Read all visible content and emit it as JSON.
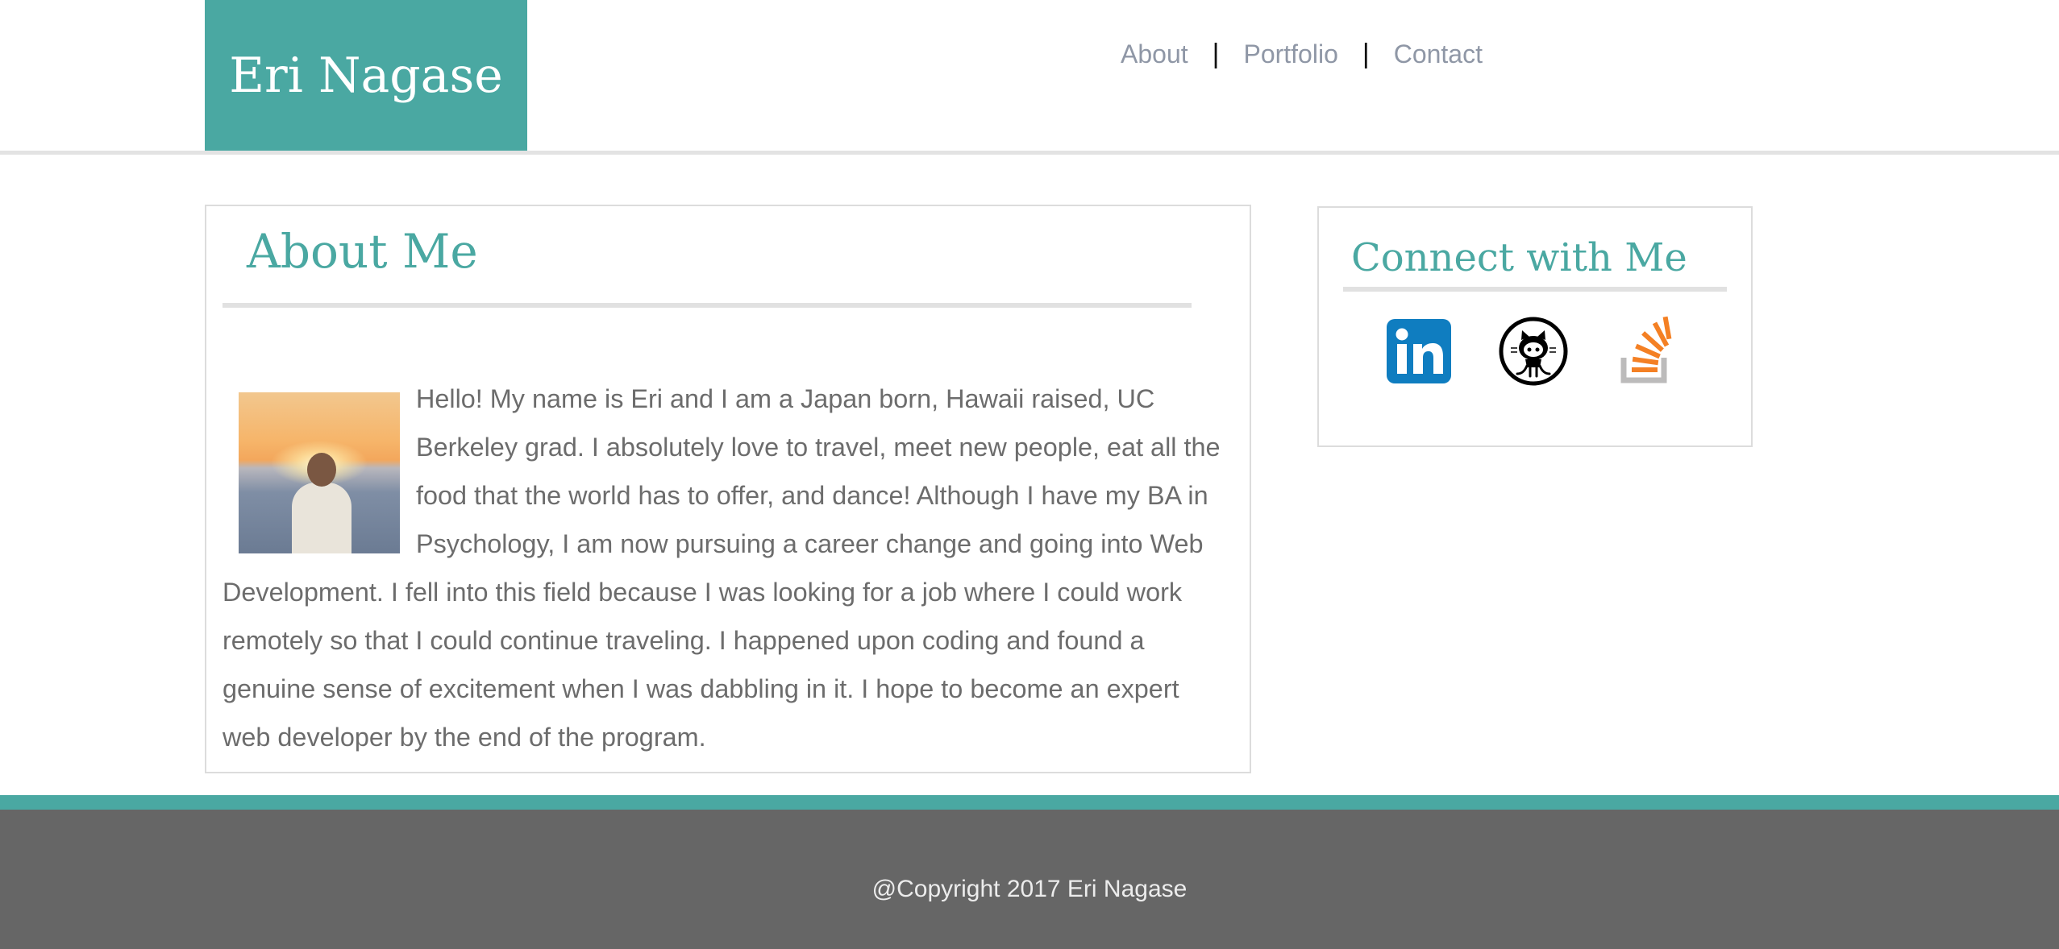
{
  "header": {
    "brand": "Eri Nagase",
    "nav": [
      {
        "label": "About"
      },
      {
        "label": "Portfolio"
      },
      {
        "label": "Contact"
      }
    ],
    "separator": "|"
  },
  "about": {
    "title": "About Me",
    "body": "Hello! My name is Eri and I am a Japan born, Hawaii raised, UC Berkeley grad. I absolutely love to travel, meet new people, eat all the food that the world has to offer, and dance! Although I have my BA in Psychology, I am now pursuing a career change and going into Web Development. I fell into this field because I was looking for a job where I could work remotely so that I could continue traveling. I happened upon coding and found a genuine sense of excitement when I was dabbling in it. I hope to become an expert web developer by the end of the program."
  },
  "connect": {
    "title": "Connect with Me",
    "icons": [
      "linkedin-icon",
      "github-icon",
      "stackoverflow-icon"
    ]
  },
  "footer": {
    "copyright": "@Copyright 2017 Eri Nagase"
  },
  "colors": {
    "accent": "#4aa8a2",
    "nav_text": "#8f97a6",
    "body_text": "#6c6c6c",
    "footer_bg": "#666666",
    "linkedin": "#0f7dc0",
    "stackoverflow": "#f48024"
  }
}
